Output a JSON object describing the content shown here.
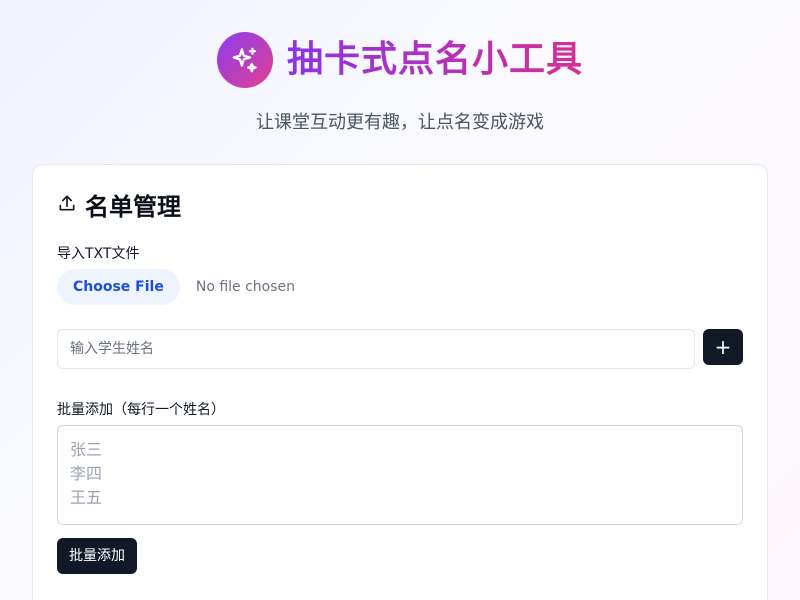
{
  "app": {
    "title": "抽卡式点名小工具",
    "subtitle": "让课堂互动更有趣，让点名变成游戏",
    "logo_icon": "sparkles-icon"
  },
  "roster": {
    "title": "名单管理",
    "title_icon": "upload-icon",
    "import_label": "导入TXT文件",
    "file_button": "Choose File",
    "file_status": "No file chosen",
    "name_input_placeholder": "输入学生姓名",
    "name_input_value": "",
    "add_button_icon": "plus-icon",
    "add_button_label": "+",
    "batch_label": "批量添加（每行一个姓名）",
    "batch_placeholder": "张三\n李四\n王五",
    "batch_value": "",
    "batch_button": "批量添加"
  },
  "colors": {
    "accent_start": "#8b3cf0",
    "accent_end": "#e3418f",
    "button_dark": "#111827",
    "file_button_bg": "#eef4ff",
    "file_button_text": "#1d4ed8"
  }
}
